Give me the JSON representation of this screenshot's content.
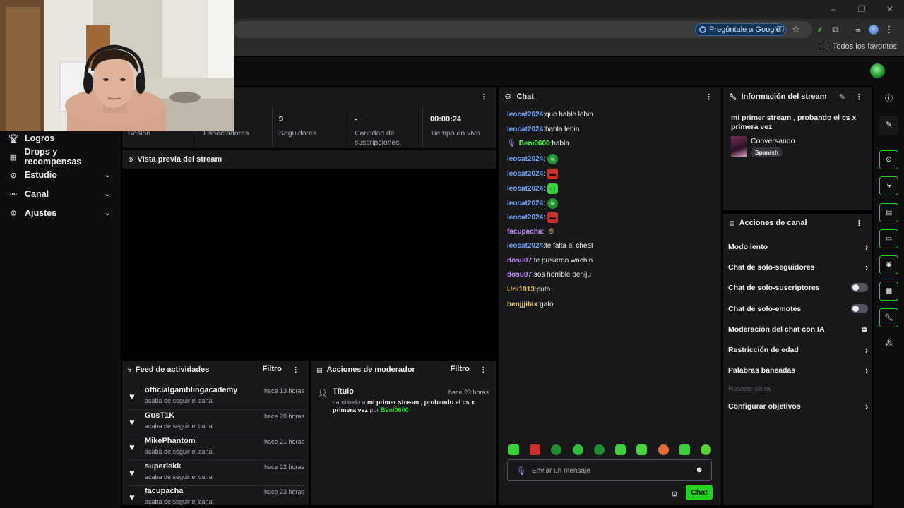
{
  "browser": {
    "window_controls": [
      "–",
      "❐",
      "✕"
    ],
    "gemini_chip": "Pregúntale a Google",
    "bookmarks_all": "Todos los favoritos"
  },
  "nav": {
    "items": [
      {
        "label": "Logros",
        "icon": "trophy-icon"
      },
      {
        "label": "Drops y recompensas",
        "icon": "gift-icon"
      },
      {
        "label": "Estudio",
        "icon": "studio-icon",
        "expandable": true
      },
      {
        "label": "Canal",
        "icon": "channel-icon",
        "expandable": true
      },
      {
        "label": "Ajustes",
        "icon": "gear-icon",
        "expandable": true
      }
    ]
  },
  "stats": [
    {
      "value": "",
      "label": "Sesión"
    },
    {
      "value": "",
      "label": "Espectadores"
    },
    {
      "value": "9",
      "label": "Seguidores"
    },
    {
      "value": "-",
      "label": "Cantidad de suscripciones"
    },
    {
      "value": "00:00:24",
      "label": "Tiempo en vivo"
    }
  ],
  "preview": {
    "title": "Vista previa del stream"
  },
  "feed": {
    "title": "Feed de actividades",
    "filter": "Filtro",
    "items": [
      {
        "name": "officialgamblingacademy",
        "action": "acaba de seguir el canal",
        "time": "hace 13 horas"
      },
      {
        "name": "GusT1K",
        "action": "acaba de seguir el canal",
        "time": "hace 20 horas"
      },
      {
        "name": "MikePhantom",
        "action": "acaba de seguir el canal",
        "time": "hace 21 horas"
      },
      {
        "name": "superiekk",
        "action": "acaba de seguir el canal",
        "time": "hace 22 horas"
      },
      {
        "name": "facupacha",
        "action": "acaba de seguir el canal",
        "time": "hace 23 horas"
      }
    ]
  },
  "mod": {
    "title": "Acciones de moderador",
    "filter": "Filtro",
    "item": {
      "title": "Título",
      "time": "hace 23 horas",
      "prefix": "cambiado a",
      "value": "mi primer stream , probando el cs x primera vez",
      "by": "por",
      "user": "Beni0600"
    }
  },
  "chat": {
    "title": "Chat",
    "messages": [
      {
        "user": "leocat2024",
        "color": "#6ea8ff",
        "text": "que hable lebin"
      },
      {
        "user": "leocat2024",
        "color": "#6ea8ff",
        "text": "habla lebin"
      },
      {
        "user": "Beni0600",
        "color": "#5cff5c",
        "text": "habla",
        "badge": "mic-badge-icon"
      },
      {
        "user": "leocat2024",
        "color": "#6ea8ff",
        "emote": "skull-green"
      },
      {
        "user": "leocat2024",
        "color": "#6ea8ff",
        "emote": "red-block"
      },
      {
        "user": "leocat2024",
        "color": "#6ea8ff",
        "emote": "green-face"
      },
      {
        "user": "leocat2024",
        "color": "#6ea8ff",
        "emote": "skull-green"
      },
      {
        "user": "leocat2024",
        "color": "#6ea8ff",
        "emote": "red-block"
      },
      {
        "user": "facupacha",
        "color": "#c58cff",
        "emote": "hand"
      },
      {
        "user": "leocat2024",
        "color": "#6ea8ff",
        "text": "te falta el cheat"
      },
      {
        "user": "dosu07",
        "color": "#c58cff",
        "text": "te pusieron wachin"
      },
      {
        "user": "dosu07",
        "color": "#c58cff",
        "text": "sos horrible beniju"
      },
      {
        "user": "Urii1913",
        "color": "#e6c46a",
        "text": "puto"
      },
      {
        "user": "benjjjitax",
        "color": "#f0d27a",
        "text": "gato"
      }
    ],
    "placeholder": "Enviar un mensaje",
    "send_label": "Chat"
  },
  "info": {
    "title": "Información del stream",
    "stream_title": "mi primer stream , probando el cs x primera vez",
    "category": "Conversando",
    "tag": "Spanish"
  },
  "actions": {
    "title": "Acciones de canal",
    "items": [
      {
        "label": "Modo lento",
        "type": "chevron"
      },
      {
        "label": "Chat de solo-seguidores",
        "type": "chevron"
      },
      {
        "label": "Chat de solo-suscriptores",
        "type": "toggle"
      },
      {
        "label": "Chat de solo-emotes",
        "type": "toggle"
      },
      {
        "label": "Moderación del chat con IA",
        "type": "external"
      },
      {
        "label": "Restricción de edad",
        "type": "chevron"
      },
      {
        "label": "Palabras baneadas",
        "type": "chevron"
      },
      {
        "label": "Hostear canal",
        "type": "disabled"
      },
      {
        "label": "Configurar objetivos",
        "type": "chevron"
      }
    ]
  },
  "colors": {
    "accent": "#25d01f",
    "panel": "#18181b",
    "background": "#0e0e10"
  }
}
